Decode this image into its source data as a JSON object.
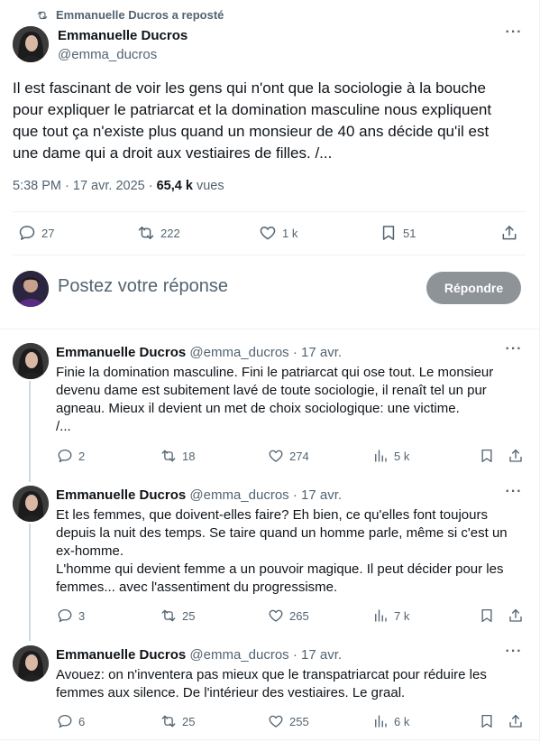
{
  "repost": {
    "icon": "repost-icon",
    "text": "Emmanuelle Ducros a reposté"
  },
  "main_tweet": {
    "author_name": "Emmanuelle Ducros",
    "handle": "@emma_ducros",
    "text": "Il est fascinant de voir les gens qui n'ont que la sociologie à  la bouche\npour expliquer le patriarcat et  la domination masculine nous expliquent\nque tout ça n'existe plus quand un monsieur de 40 ans décide qu'il est\nune dame qui a droit aux vestiaires de filles. /...",
    "time": "5:38 PM · 17 avr. 2025 · ",
    "views": "65,4 k",
    "views_label": " vues",
    "replies": "27",
    "reposts": "222",
    "likes": "1 k",
    "bookmarks": "51"
  },
  "composer": {
    "placeholder": "Postez votre réponse",
    "button_label": "Répondre"
  },
  "thread": [
    {
      "author_name": "Emmanuelle Ducros",
      "handle": "@emma_ducros",
      "date": "· 17 avr.",
      "text": "Finie la domination masculine. Fini le patriarcat qui ose tout. Le monsieur\ndevenu dame est subitement lavé de toute sociologie, il renaît tel un pur\nagneau. Mieux il devient un met de choix sociologique: une victime.\n/...",
      "replies": "2",
      "reposts": "18",
      "likes": "274",
      "views": "5 k"
    },
    {
      "author_name": "Emmanuelle Ducros",
      "handle": "@emma_ducros",
      "date": "· 17 avr.",
      "text": "Et les femmes, que doivent-elles faire? Eh bien, ce qu'elles font toujours\ndepuis la nuit des temps. Se taire quand un homme parle, même si c'est un\nex-homme.\n L'homme qui devient femme  a un pouvoir magique. Il peut décider pour les\nfemmes... avec l'assentiment du progressisme.",
      "replies": "3",
      "reposts": "25",
      "likes": "265",
      "views": "7 k"
    },
    {
      "author_name": "Emmanuelle Ducros",
      "handle": "@emma_ducros",
      "date": "· 17 avr.",
      "text": "Avouez: on n'inventera pas mieux que le transpatriarcat pour réduire les\nfemmes aux silence. De l'intérieur des vestiaires. Le graal.",
      "replies": "6",
      "reposts": "25",
      "likes": "255",
      "views": "6 k"
    }
  ],
  "icons": [
    "repost-icon",
    "more-icon",
    "reply-icon",
    "like-icon",
    "bookmark-icon",
    "share-icon",
    "views-icon"
  ],
  "colors": {
    "text": "#0f1419",
    "muted": "#536471",
    "divider": "#eff3f4",
    "thread_line": "#cfd9de",
    "button": "#8e9398"
  }
}
